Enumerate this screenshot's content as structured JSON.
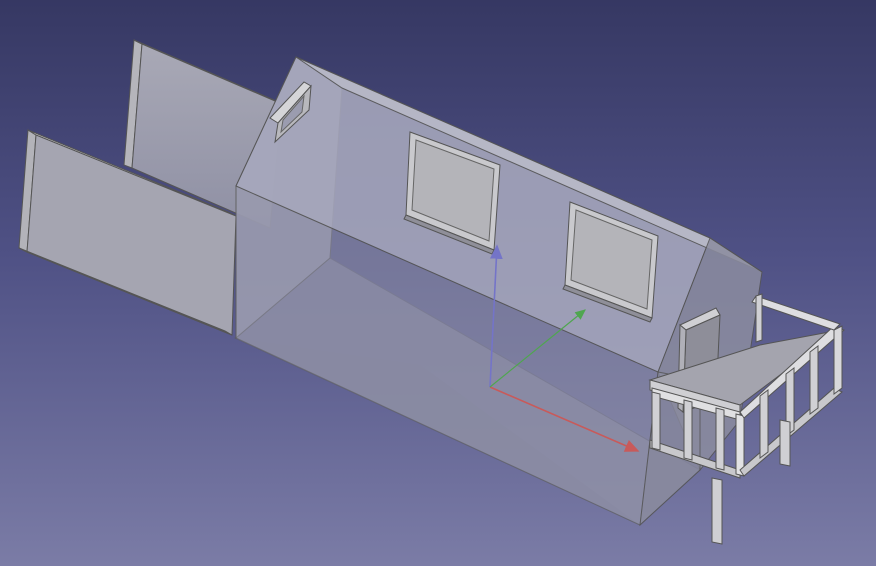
{
  "app": {
    "name": "3D view",
    "background_top": "#363863",
    "background_bottom": "#7b7ca6"
  },
  "scene": {
    "model": "house",
    "axes": {
      "x_color": "#c85a5a",
      "y_color": "#4fa64f",
      "z_color": "#7474c8"
    }
  }
}
